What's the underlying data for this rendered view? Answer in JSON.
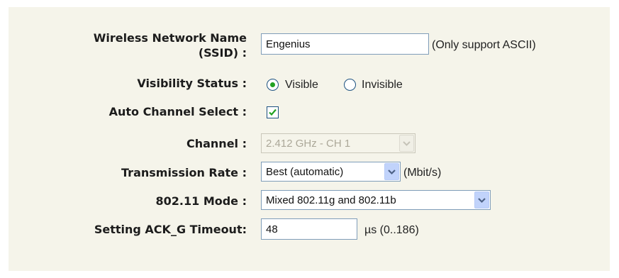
{
  "form": {
    "ssid": {
      "label_line1": "Wireless Network Name",
      "label_line2": "(SSID) :",
      "value": "Engenius",
      "note": "(Only support ASCII)"
    },
    "visibility": {
      "label": "Visibility Status :",
      "options": [
        "Visible",
        "Invisible"
      ],
      "selected": "Visible"
    },
    "auto_channel": {
      "label": "Auto Channel Select :",
      "checked": true
    },
    "channel": {
      "label": "Channel :",
      "value": "2.412 GHz - CH 1",
      "disabled": true
    },
    "tx_rate": {
      "label": "Transmission Rate :",
      "value": "Best (automatic)",
      "unit": "(Mbit/s)"
    },
    "mode": {
      "label": "802.11 Mode :",
      "value": "Mixed 802.11g and 802.11b"
    },
    "ack_timeout": {
      "label": "Setting ACK_G Timeout:",
      "value": "48",
      "range": "µs (0..186)"
    }
  },
  "colors": {
    "panel_bg": "#f5f4ea",
    "radio_selected": "#21a121",
    "check_mark": "#21a121",
    "dropdown_button": "#c1d3fb"
  },
  "icons": {
    "dropdown": "chevron-down-icon",
    "check": "checkmark-icon"
  }
}
